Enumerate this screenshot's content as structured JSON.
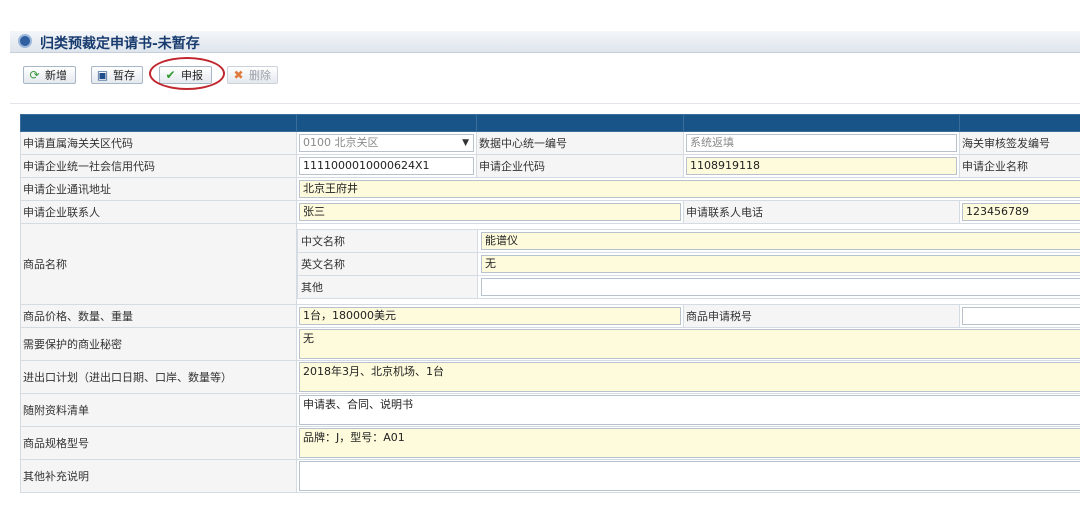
{
  "window": {
    "title": "归类预裁定申请书-未暂存"
  },
  "toolbar": {
    "new_label": "新增",
    "save_label": "暂存",
    "submit_label": "申报",
    "delete_label": "删除"
  },
  "form": {
    "customs_code": {
      "label": "申请直属海关关区代码",
      "value": "0100 北京关区"
    },
    "data_center_no": {
      "label": "数据中心统一编号",
      "value": "系统返填"
    },
    "approval_no": {
      "label": "海关审核签发编号"
    },
    "credit_code": {
      "label": "申请企业统一社会信用代码",
      "value": "1111000010000624X1"
    },
    "enterprise_code": {
      "label": "申请企业代码",
      "value": "1108919118"
    },
    "enterprise_name": {
      "label": "申请企业名称"
    },
    "address": {
      "label": "申请企业通讯地址",
      "value": "北京王府井"
    },
    "contact": {
      "label": "申请企业联系人",
      "value": "张三"
    },
    "phone": {
      "label": "申请联系人电话",
      "value": "123456789"
    },
    "goods_name": {
      "label": "商品名称",
      "cn_label": "中文名称",
      "cn_value": "能谱仪",
      "en_label": "英文名称",
      "en_value": "无",
      "other_label": "其他",
      "other_value": ""
    },
    "price": {
      "label": "商品价格、数量、重量",
      "value": "1台，180000美元"
    },
    "tariff_no": {
      "label": "商品申请税号",
      "value": ""
    },
    "secret": {
      "label": "需要保护的商业秘密",
      "value": "无"
    },
    "plan": {
      "label": "进出口计划（进出口日期、口岸、数量等）",
      "value": "2018年3月、北京机场、1台"
    },
    "attachments": {
      "label": "随附资料清单",
      "value": "申请表、合同、说明书"
    },
    "model": {
      "label": "商品规格型号",
      "value": "品牌：J，型号：A01"
    },
    "remarks": {
      "label": "其他补充说明",
      "value": ""
    }
  },
  "colors": {
    "header_bar": "#185488",
    "highlight_circle": "#c0262d",
    "required_field_bg": "#fefbdc"
  }
}
